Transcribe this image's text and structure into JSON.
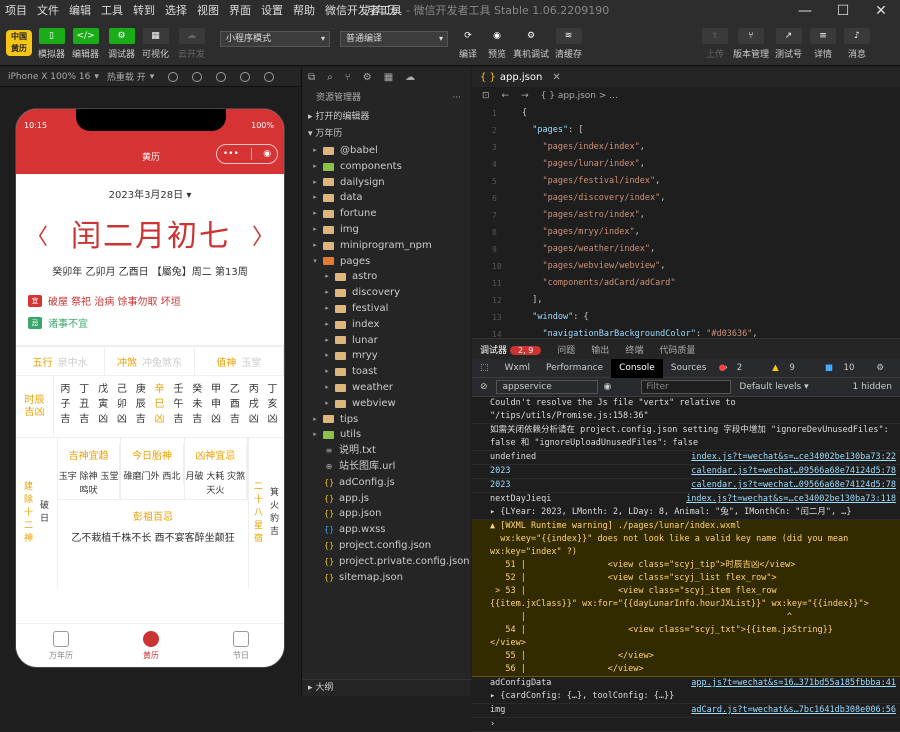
{
  "menu": {
    "items": [
      "项目",
      "文件",
      "编辑",
      "工具",
      "转到",
      "选择",
      "视图",
      "界面",
      "设置",
      "帮助",
      "微信开发者工具"
    ],
    "app_title": "万年历",
    "app_subtitle": "- 微信开发者工具 Stable 1.06.2209190"
  },
  "toolbar": {
    "logo": "中国 黄历",
    "simulator": "模拟器",
    "editor": "编辑器",
    "debugger": "调试器",
    "visual": "可视化",
    "cloud": "云开发",
    "mode": "小程序模式",
    "compile_mode": "普通编译",
    "compile": "编译",
    "preview": "预览",
    "real_debug": "真机调试",
    "clear_cache": "清缓存",
    "upload": "上传",
    "version": "版本管理",
    "test": "测试号",
    "detail": "详情",
    "message": "消息"
  },
  "simulator": {
    "device": "iPhone X 100% 16",
    "hotreload": "热重载 开"
  },
  "phone": {
    "time": "10:15",
    "battery": "100%",
    "title": "黄历",
    "date": "2023年3月28日",
    "lunar": "闰二月初七",
    "ganzhi": "癸卯年 乙卯月 乙酉日 【屬兔】周二 第13周",
    "yi_badge": "宜",
    "yi": "破屋 祭祀 治病 馀事勿取 坏垣",
    "ji_badge": "忌",
    "ji": "诸事不宜",
    "row": [
      {
        "k": "五行",
        "v": "泉中水"
      },
      {
        "k": "冲煞",
        "v": "冲兔煞东"
      },
      {
        "k": "值神",
        "v": "玉堂"
      }
    ],
    "shichen_label": "时辰吉凶",
    "shichen": [
      [
        "丙",
        "子",
        "吉"
      ],
      [
        "丁",
        "丑",
        "吉"
      ],
      [
        "戊",
        "寅",
        "凶"
      ],
      [
        "己",
        "卯",
        "凶"
      ],
      [
        "庚",
        "辰",
        "吉"
      ],
      [
        "辛",
        "巳",
        "凶"
      ],
      [
        "壬",
        "午",
        "吉"
      ],
      [
        "癸",
        "未",
        "吉"
      ],
      [
        "甲",
        "申",
        "凶"
      ],
      [
        "乙",
        "酉",
        "吉"
      ],
      [
        "丙",
        "戌",
        "凶"
      ],
      [
        "丁",
        "亥",
        "凶"
      ]
    ],
    "left_label": "建除十二神",
    "left_value": "破日",
    "boxes": [
      {
        "h": "吉神宜趋",
        "t": "玉宇 除神 玉堂 鸣吠"
      },
      {
        "h": "今日胎神",
        "t": "碓磨门外 西北"
      },
      {
        "h": "凶神宜忌",
        "t": "月破 大耗 灾煞 天火"
      }
    ],
    "right_label": "二十八星宿",
    "right_value": "箕火豹吉",
    "pengzu_h": "彭祖百忌",
    "pengzu": "乙不栽植千株不长 酉不宴客醉坐颠狂",
    "tabs": [
      "万年历",
      "黄历",
      "节日"
    ]
  },
  "explorer": {
    "title": "资源管理器",
    "opened": "打开的编辑器",
    "project": "万年历",
    "tree": [
      {
        "n": "@babel",
        "t": "folder",
        "d": 1
      },
      {
        "n": "components",
        "t": "folderg",
        "d": 1
      },
      {
        "n": "dailysign",
        "t": "folder",
        "d": 1
      },
      {
        "n": "data",
        "t": "folder",
        "d": 1
      },
      {
        "n": "fortune",
        "t": "folder",
        "d": 1
      },
      {
        "n": "img",
        "t": "folder",
        "d": 1
      },
      {
        "n": "miniprogram_npm",
        "t": "folder",
        "d": 1
      },
      {
        "n": "pages",
        "t": "foldero",
        "d": 1,
        "open": true
      },
      {
        "n": "astro",
        "t": "folder",
        "d": 2
      },
      {
        "n": "discovery",
        "t": "folder",
        "d": 2
      },
      {
        "n": "festival",
        "t": "folder",
        "d": 2
      },
      {
        "n": "index",
        "t": "folder",
        "d": 2
      },
      {
        "n": "lunar",
        "t": "folder",
        "d": 2
      },
      {
        "n": "mryy",
        "t": "folder",
        "d": 2
      },
      {
        "n": "toast",
        "t": "folder",
        "d": 2
      },
      {
        "n": "weather",
        "t": "folder",
        "d": 2
      },
      {
        "n": "webview",
        "t": "folder",
        "d": 2
      },
      {
        "n": "tips",
        "t": "folder",
        "d": 1
      },
      {
        "n": "utils",
        "t": "folderg",
        "d": 1
      },
      {
        "n": "说明.txt",
        "t": "txt",
        "d": 1
      },
      {
        "n": "站长图库.url",
        "t": "url",
        "d": 1
      },
      {
        "n": "adConfig.js",
        "t": "js",
        "d": 1
      },
      {
        "n": "app.js",
        "t": "js",
        "d": 1
      },
      {
        "n": "app.json",
        "t": "json",
        "d": 1
      },
      {
        "n": "app.wxss",
        "t": "wxss",
        "d": 1
      },
      {
        "n": "project.config.json",
        "t": "json",
        "d": 1
      },
      {
        "n": "project.private.config.json",
        "t": "json",
        "d": 1
      },
      {
        "n": "sitemap.json",
        "t": "json",
        "d": 1
      }
    ],
    "outline": "大纲"
  },
  "editor": {
    "tab": "app.json",
    "crumb": "{ } app.json > ...",
    "lines": [
      {
        "n": "1",
        "c": "{"
      },
      {
        "n": "2",
        "c": "  \"pages\": ["
      },
      {
        "n": "3",
        "c": "    \"pages/index/index\","
      },
      {
        "n": "4",
        "c": "    \"pages/lunar/index\","
      },
      {
        "n": "5",
        "c": "    \"pages/festival/index\","
      },
      {
        "n": "6",
        "c": "    \"pages/discovery/index\","
      },
      {
        "n": "7",
        "c": "    \"pages/astro/index\","
      },
      {
        "n": "8",
        "c": "    \"pages/mryy/index\","
      },
      {
        "n": "9",
        "c": "    \"pages/weather/index\","
      },
      {
        "n": "10",
        "c": "    \"pages/webview/webview\","
      },
      {
        "n": "11",
        "c": "    \"components/adCard/adCard\""
      },
      {
        "n": "12",
        "c": "  ],"
      },
      {
        "n": "13",
        "c": "  \"window\": {"
      },
      {
        "n": "14",
        "c": "    \"navigationBarBackgroundColor\": \"#d03636\","
      }
    ]
  },
  "debug": {
    "tabs": [
      "调试器",
      "问题",
      "输出",
      "终端",
      "代码质量"
    ],
    "badge": "2, 9",
    "devtabs": [
      "Wxml",
      "Performance",
      "Console",
      "Sources"
    ],
    "more": "»",
    "err": "2",
    "warn": "9",
    "info": "10",
    "filter_ctx": "appservice",
    "filter_ph": "Filter",
    "levels": "Default levels ▾",
    "hidden": "1 hidden",
    "logs": [
      {
        "t": "Couldn't resolve the Js file \"vertx\" relative to \"/tips/utils/Promise.js:158:36\"",
        "s": "",
        "k": ""
      },
      {
        "t": "如需关闭依赖分析请在 project.config.json setting 字段中增加 \"ignoreDevUnusedFiles\": false 和 \"ignoreUploadUnusedFiles\": false",
        "s": "",
        "k": ""
      },
      {
        "t": "undefined",
        "s": "index.js?t=wechat&s=…ce34002be130ba73:22",
        "k": ""
      },
      {
        "t": "2023",
        "s": "calendar.js?t=wechat…09566a68e74124d5:78",
        "k": "num"
      },
      {
        "t": "2023",
        "s": "calendar.js?t=wechat…09566a68e74124d5:78",
        "k": "num"
      },
      {
        "t": "nextDayJieqi\n▸ {LYear: 2023, LMonth: 2, LDay: 8, Animal: \"兔\", IMonthCn: \"闰二月\", …}",
        "s": "index.js?t=wechat&s=…ce34002be130ba73:118",
        "k": ""
      },
      {
        "t": "▲ [WXML Runtime warning] ./pages/lunar/index.wxml\n  wx:key=\"{{index}}\" does not look like a valid key name (did you mean\nwx:key=\"index\" ?)\n   51 |                <view class=\"scyj_tip\">时辰吉凶</view>\n   52 |                <view class=\"scyj_list flex_row\">\n > 53 |                  <view class=\"scyj_item flex_row\n{{item.jxClass}}\" wx:for=\"{{dayLunarInfo.hourJXList}}\" wx:key=\"{{index}}\">\n      |                                                   ^\n   54 |                    <view class=\"scyj_txt\">{{item.jxString}}\n</view>\n   55 |                  </view>\n   56 |                </view>",
        "s": "",
        "k": "warn"
      },
      {
        "t": "adConfigData\n▸ {cardConfig: {…}, toolConfig: {…}}",
        "s": "app.js?t=wechat&s=16…371bd55a185fbbba:41",
        "k": ""
      },
      {
        "t": "img",
        "s": "adCard.js?t=wechat&s…7bc1641db308e006:56",
        "k": ""
      }
    ]
  }
}
